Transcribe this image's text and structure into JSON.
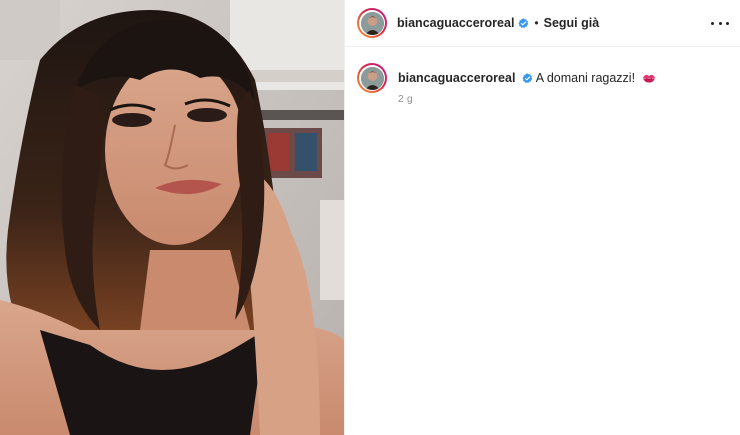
{
  "post": {
    "username": "biancaguacceroreal",
    "separator": "•",
    "follow_label": "Segui già",
    "more_options_icon": "more-horizontal-icon",
    "verified_icon": "verified-badge-icon",
    "caption": {
      "username": "biancaguacceroreal",
      "text": "A domani ragazzi!",
      "emoji_icon": "kiss-mark-icon"
    },
    "timestamp": "2 g"
  },
  "colors": {
    "verified_blue": "#3897f0",
    "text": "#262626",
    "muted": "#8e8e8e",
    "border": "#efefef"
  }
}
